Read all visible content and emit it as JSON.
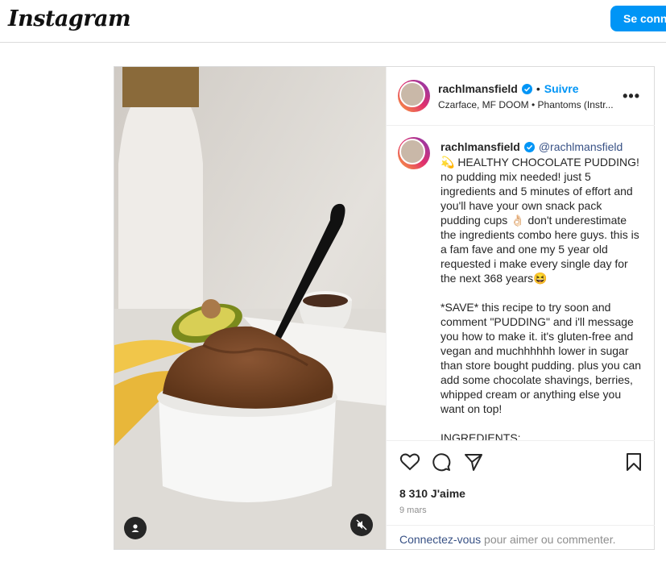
{
  "app": {
    "logo": "Instagram",
    "connect_label": "Se connecter"
  },
  "post": {
    "username": "rachlmansfield",
    "follow_label": "Suivre",
    "separator": "•",
    "audio": "Czarface, MF DOOM • Phantoms (Instr...",
    "more_label": "•••",
    "caption": {
      "username": "rachlmansfield",
      "handle": "@rachlmansfield",
      "text": "💫 HEALTHY CHOCOLATE PUDDING!\nno pudding mix needed! just 5 ingredients and 5 minutes of effort and you'll have your own snack pack pudding cups 👌🏻 don't underestimate the ingredients combo here guys. this is a fam fave and one my 5 year old requested i make every single day for the next 368 years😆\n\n*SAVE* this recipe to try soon and comment \"PUDDING\" and i'll message you how to make it. it's gluten-free and vegan and muchhhhhh lower in sugar than store bought pudding. plus you can add some chocolate shavings, berries, whipped cream or anything else you want on top!\n\nINGREDIENTS:"
    },
    "likes": "8 310 J'aime",
    "date": "9 mars",
    "login_link": "Connectez-vous",
    "login_rest": " pour aimer ou commenter."
  },
  "icons": {
    "like": "heart-icon",
    "comment": "comment-icon",
    "share": "share-icon",
    "save": "bookmark-icon",
    "verified": "verified-badge-icon",
    "user": "user-icon",
    "mute": "muted-speaker-icon"
  },
  "colors": {
    "accent": "#0095f6",
    "text": "#262626",
    "muted": "#8e8e8e",
    "link": "#385185"
  }
}
